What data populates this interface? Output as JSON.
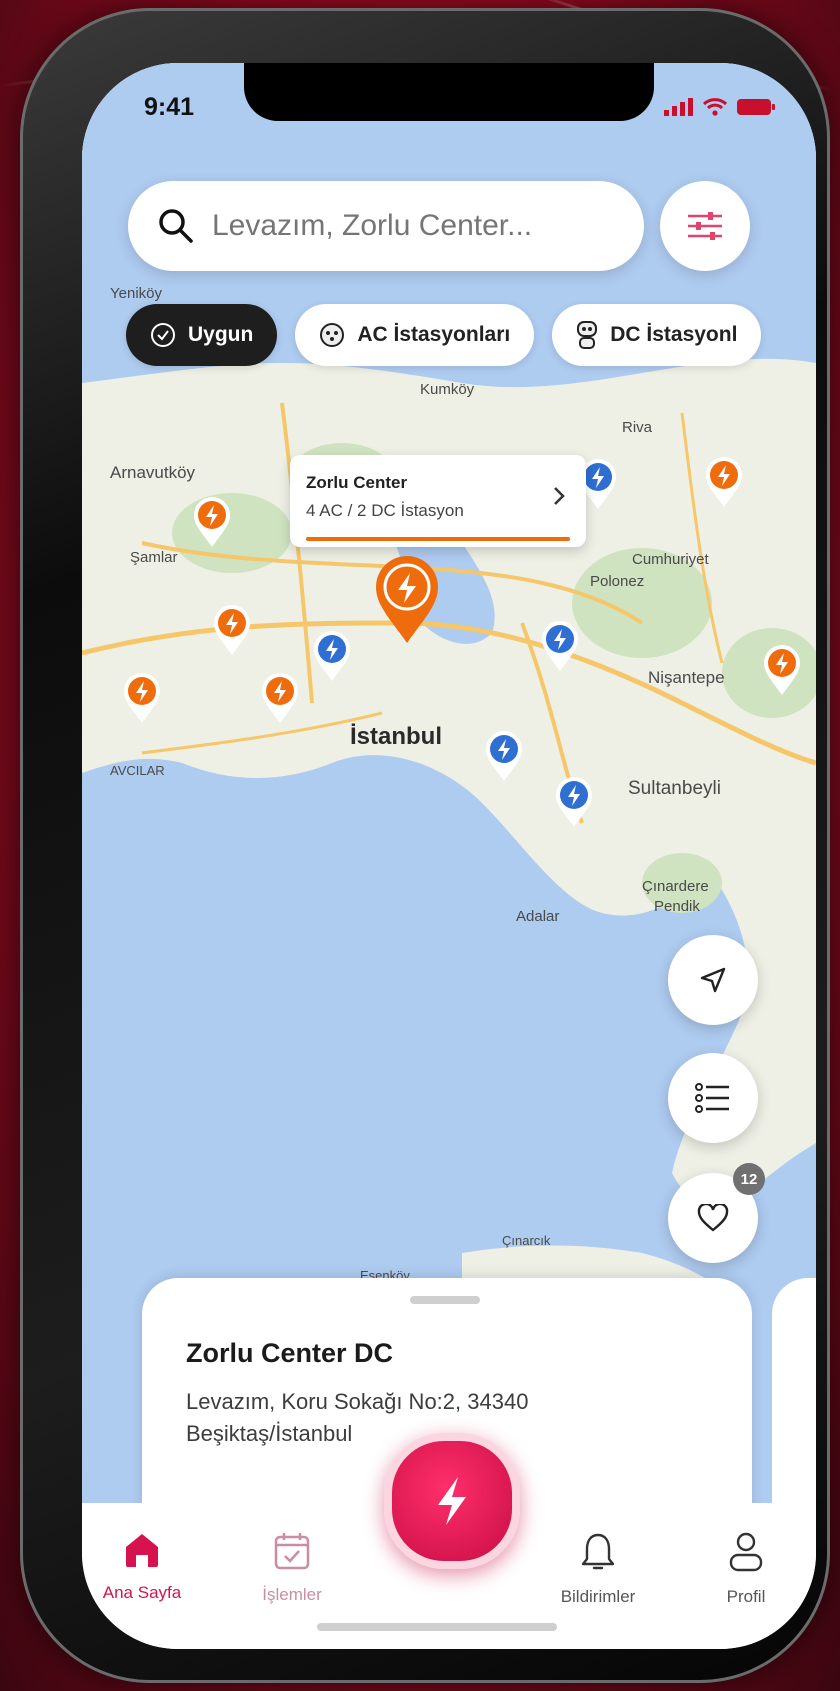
{
  "status_bar": {
    "time": "9:41"
  },
  "search": {
    "placeholder": "Levazım, Zorlu Center..."
  },
  "chips": [
    {
      "label": "Uygun",
      "active": true
    },
    {
      "label": "AC İstasyonları",
      "active": false
    },
    {
      "label": "DC İstasyonl",
      "active": false
    }
  ],
  "map_labels": [
    "Arnavutköy",
    "Şamlar",
    "Yeniköy",
    "Kumköy",
    "Riva",
    "Cumhuriyet",
    "Polonez",
    "İstanbul",
    "Nişantepe",
    "Sultanbeyli",
    "AVCILAR",
    "Adalar",
    "Çınardere",
    "Pendik",
    "Çınarcık",
    "Esenköy"
  ],
  "popup": {
    "title": "Zorlu Center",
    "subtitle": "4 AC / 2 DC İstasyon"
  },
  "favorites_badge": "12",
  "station_card": {
    "title": "Zorlu Center DC",
    "address": "Levazım, Koru Sokağı No:2, 34340 Beşiktaş/İstanbul"
  },
  "nav": {
    "items": [
      {
        "label": "Ana Sayfa",
        "icon": "home-icon",
        "active": true
      },
      {
        "label": "İşlemler",
        "icon": "calendar-check-icon",
        "active": false
      },
      {
        "label": "Bildirimler",
        "icon": "bell-icon",
        "active": false
      },
      {
        "label": "Profil",
        "icon": "user-icon",
        "active": false
      }
    ]
  },
  "colors": {
    "accent": "#d6134e",
    "ac_pin": "#ef6c0c",
    "dc_pin": "#2f6fd1",
    "background": "#c8102e"
  }
}
